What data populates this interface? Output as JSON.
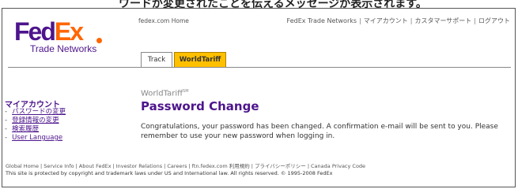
{
  "top_band": {
    "text": "ワードが変更されたことを伝えるメッセージが表示されます。"
  },
  "logo": {
    "fed": "Fed",
    "ex": "Ex",
    "sub": "Trade Networks"
  },
  "header": {
    "home_link": "fedex.com Home",
    "nav": [
      "FedEx Trade Networks",
      "マイアカウント",
      "カスタマーサポート",
      "ログアウト"
    ],
    "separator": "|"
  },
  "tabs": [
    {
      "label": "Track",
      "active": false
    },
    {
      "label": "WorldTariff",
      "active": true
    }
  ],
  "sidebar": {
    "title": "マイアカウント",
    "items": [
      {
        "label": "パスワードの変更"
      },
      {
        "label": "登録情報の変更"
      },
      {
        "label": "検索履歴"
      },
      {
        "label": "User Language"
      }
    ]
  },
  "main": {
    "product": "WorldTariff",
    "product_mark": "SM",
    "title": "Password Change",
    "message": "Congratulations, your password has been changed. A confirmation e-mail will be sent to you. Please remember to use your new password when logging in."
  },
  "footer": {
    "links": [
      "Global Home",
      "Service Info",
      "About FedEx",
      "Investor Relations",
      "Careers",
      "ftn.fedex.com 利用規約",
      "プライバシーポリシー",
      "Canada Privacy Code"
    ],
    "copyright": "This site is protected by copyright and trademark laws under US and International law. All rights reserved. © 1995-2008 FedEx"
  },
  "colors": {
    "purple": "#4d148c",
    "orange": "#ff6600",
    "tab_active": "#ffc000"
  }
}
